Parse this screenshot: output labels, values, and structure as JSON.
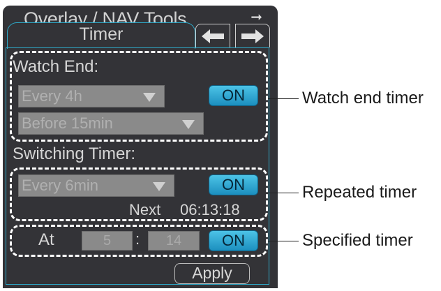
{
  "panel": {
    "title": "Overlay / NAV Tools",
    "tab_label": "Timer"
  },
  "watch_end": {
    "heading": "Watch End:",
    "interval": "Every 4h",
    "before": "Before 15min",
    "toggle": "ON"
  },
  "switching": {
    "heading": "Switching Timer:",
    "interval": "Every 6min",
    "toggle": "ON",
    "next_label": "Next",
    "next_time": "06:13:18"
  },
  "specified": {
    "at_label": "At",
    "hour": "5",
    "separator": ":",
    "minute": "14",
    "toggle": "ON"
  },
  "apply_label": "Apply",
  "callouts": {
    "watch_end": "Watch end timer",
    "repeated": "Repeated timer",
    "specified": "Specified timer"
  },
  "colors": {
    "panel_bg": "#333337",
    "accent_border": "#2ea7c6",
    "toggle_on": "#33aed8",
    "disabled_field": "#8a8a8a"
  },
  "icons": {
    "title_arrow": "right-arrow-icon",
    "nav_prev": "left-arrow-icon",
    "nav_next": "right-arrow-icon"
  }
}
